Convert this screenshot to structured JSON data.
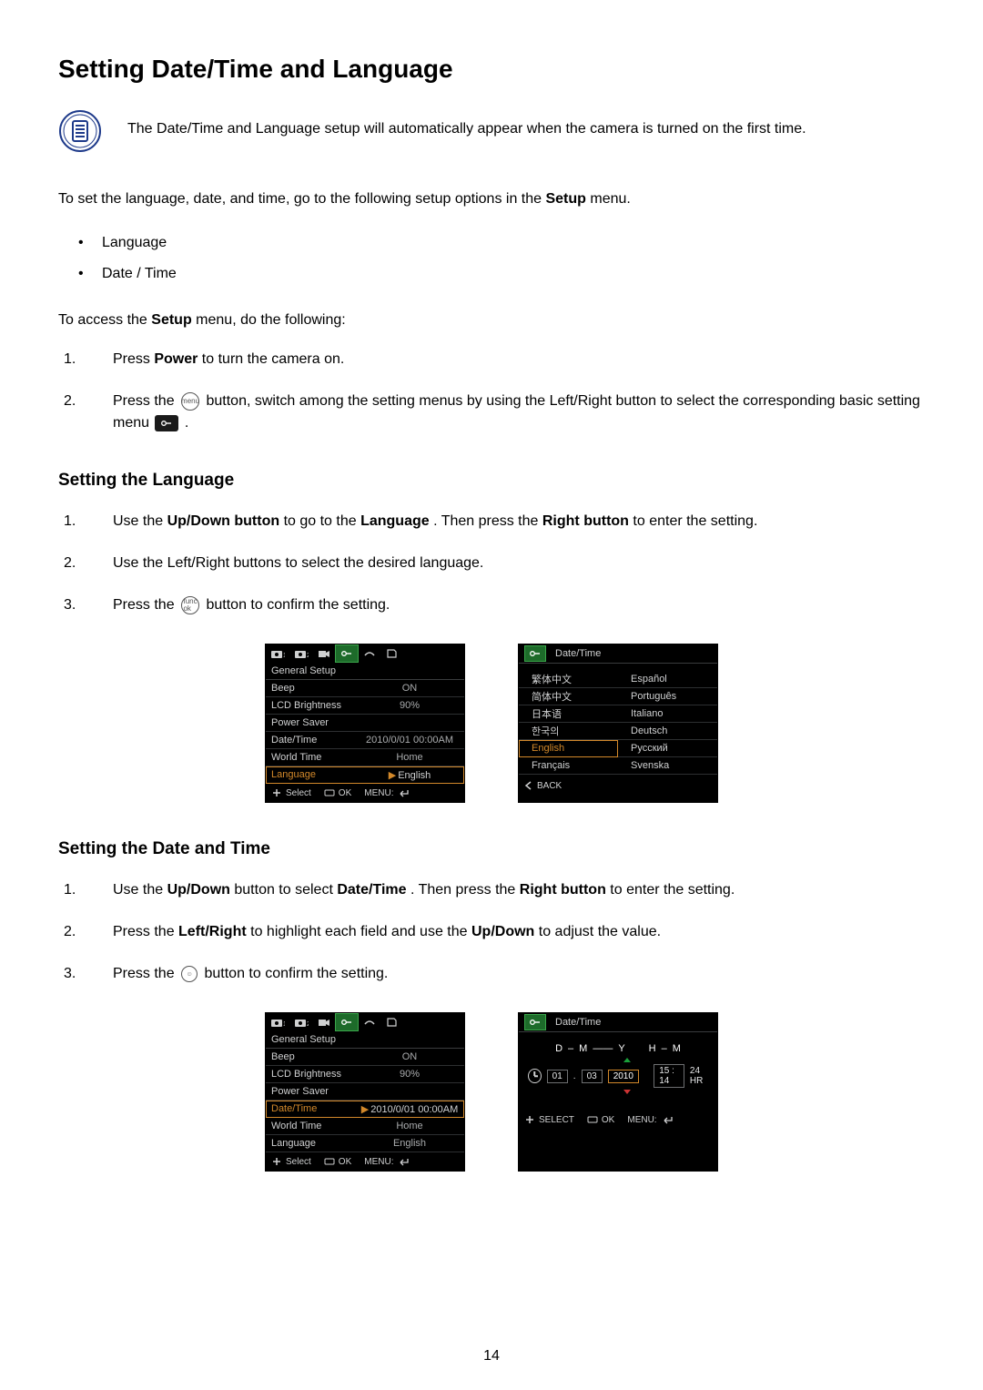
{
  "page_number": "14",
  "h1": "Setting Date/Time and Language",
  "intro": "The Date/Time and Language setup will automatically appear when the camera is turned on the first time.",
  "lead": {
    "pre": "To set the language, date, and time, go to the following setup options in the ",
    "bold": "Setup",
    "post": " menu."
  },
  "bullets": [
    "Language",
    "Date / Time"
  ],
  "access": {
    "pre": "To access the ",
    "bold": "Setup",
    "post": " menu, do the following:"
  },
  "access_steps": {
    "s1": {
      "pre": "Press  ",
      "b1": "Power",
      "post": "  to turn the camera on."
    },
    "s2": {
      "pre": "Press the ",
      "menu_label": "menu",
      "mid": " button,  switch among the setting menus by using the Left/Right button to select the corresponding basic setting menu ",
      "post": " ."
    }
  },
  "h2_lang": "Setting the Language",
  "lang_steps": {
    "s1": {
      "a": "Use the ",
      "b1": "Up/Down button",
      "c": " to go to the ",
      "b2": "Language",
      "d": ". Then press the ",
      "b3": "Right button",
      "e": " to enter the setting."
    },
    "s2": "Use the Left/Right buttons to select the desired language.",
    "s3": {
      "a": "Press the ",
      "btn": "func\nok",
      "b": " button to confirm the setting."
    }
  },
  "osd_general": {
    "title": "General Setup",
    "rows": [
      {
        "lab": "Beep",
        "val": "ON"
      },
      {
        "lab": "LCD Brightness",
        "val": "90%"
      },
      {
        "lab": "Power Saver",
        "val": ""
      },
      {
        "lab": "Date/Time",
        "val": "2010/0/01 00:00AM"
      },
      {
        "lab": "World Time",
        "val": "Home"
      },
      {
        "lab": "Language",
        "val": "English"
      }
    ],
    "foot_select": "Select",
    "foot_ok": "OK",
    "foot_menu": "MENU:"
  },
  "osd_lang": {
    "head": "Date/Time",
    "left": [
      "繁体中文",
      "简体中文",
      "日本语",
      "한국의",
      "English",
      "Français"
    ],
    "right": [
      "Español",
      "Português",
      "Italiano",
      "Deutsch",
      "Русский",
      "Svenska"
    ],
    "selected": "English",
    "back": "BACK"
  },
  "h2_date": "Setting the Date and Time",
  "date_steps": {
    "s1": {
      "a": "Use the ",
      "b1": "Up/Down",
      "c": " button to select ",
      "b2": "Date/Time",
      "d": ". Then press the ",
      "b3": "Right button",
      "e": " to enter the setting."
    },
    "s2": {
      "a": "Press the ",
      "b1": "Left/Right",
      "c": " to highlight each field and use the ",
      "b2": "Up/Down",
      "d": " to adjust the value."
    },
    "s3": {
      "a": "Press the ",
      "b": " button to confirm the setting."
    }
  },
  "osd_dt": {
    "head": "Date/Time",
    "fmt_d": "D",
    "fmt_m": "M",
    "fmt_y": "Y",
    "fmt_h": "H",
    "fmt_m2": "M",
    "day": "01",
    "dot": ".",
    "mon": "03",
    "year": "2010",
    "time": "15 : 14",
    "mode": "24 HR",
    "foot_select": "SELECT",
    "foot_ok": "OK",
    "foot_menu": "MENU:"
  }
}
